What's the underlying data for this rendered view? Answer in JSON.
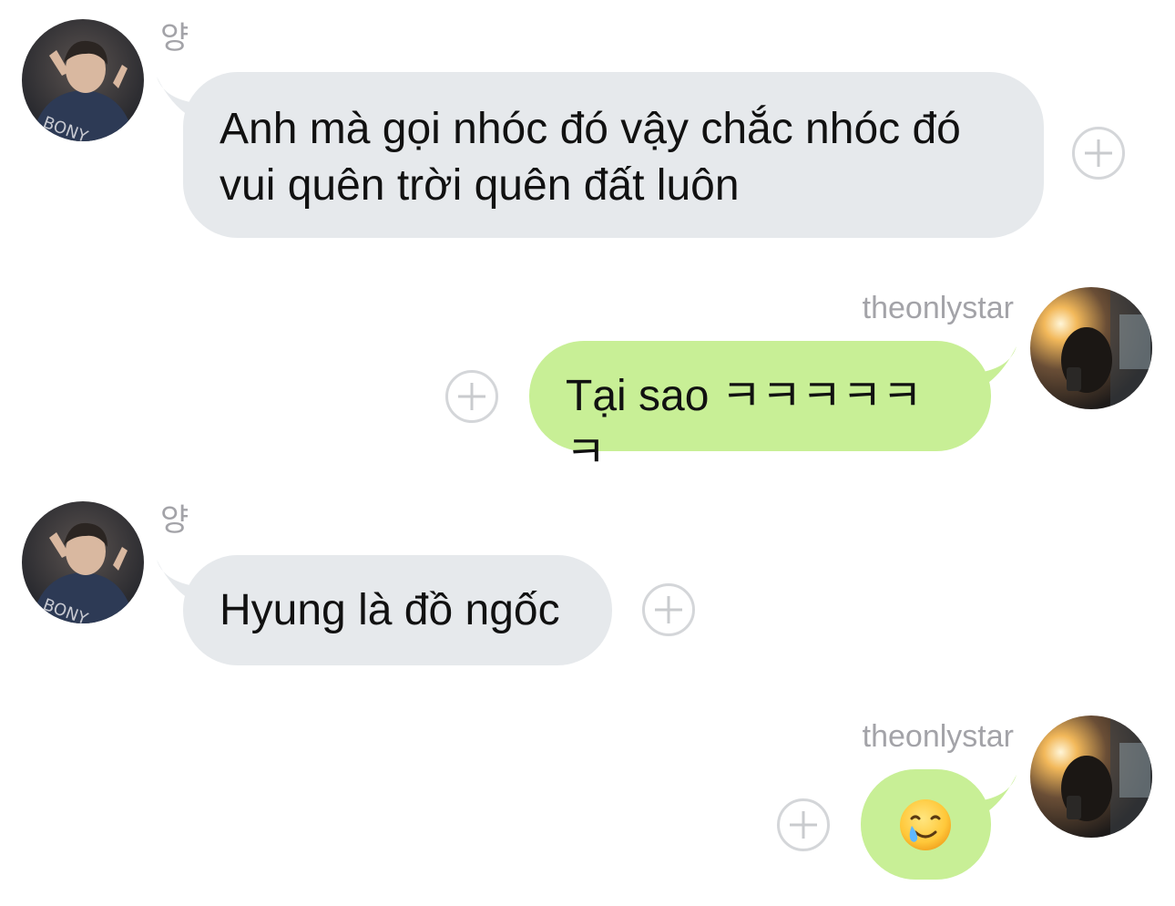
{
  "messages": [
    {
      "side": "incoming",
      "sender": "양",
      "lines": [
        "Anh mà gọi nhóc đó vậy chắc nhóc đó",
        "vui quên trời quên đất luôn"
      ]
    },
    {
      "side": "outgoing",
      "sender": "theonlystar",
      "text": "Tại sao ㅋㅋㅋㅋㅋㅋ"
    },
    {
      "side": "incoming",
      "sender": "양",
      "text": "Hyung là đồ ngốc"
    },
    {
      "side": "outgoing",
      "sender": "theonlystar",
      "emoji": "smiling-face-with-tear"
    }
  ],
  "colors": {
    "incoming_bubble": "#e6e9ec",
    "outgoing_bubble": "#c8ef96",
    "sender_name": "#a3a3a8",
    "plus_circle": "#d4d6d9"
  }
}
